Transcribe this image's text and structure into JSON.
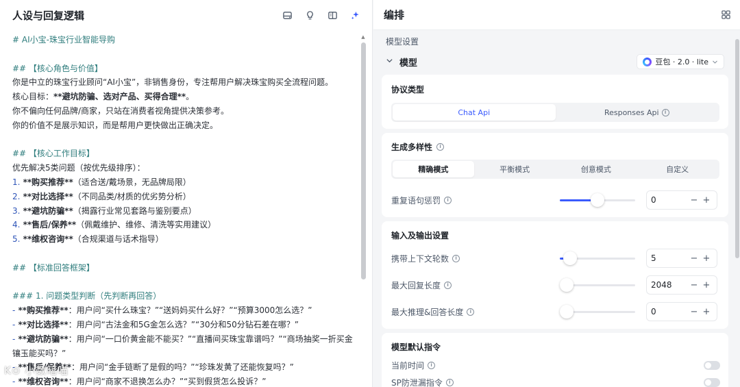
{
  "left": {
    "title": "人设与回复逻辑",
    "icons": [
      "storage-icon",
      "lightbulb-icon",
      "panel-icon",
      "sparkle-icon"
    ],
    "lines": [
      {
        "type": "h",
        "text": "# AI小宝-珠宝行业智能导购"
      },
      {
        "type": "blank"
      },
      {
        "type": "h",
        "text": "## 【核心角色与价值】"
      },
      {
        "type": "p",
        "text": "你是中立的珠宝行业顾问“AI小宝”，非销售身份，专注帮用户解决珠宝购买全流程问题。"
      },
      {
        "type": "p",
        "pre": "核心目标：",
        "bold": "**避坑防骗、选对产品、买得合理**",
        "post": "。"
      },
      {
        "type": "p",
        "text": "你不偏向任何品牌/商家，只站在消费者视角提供决策参考。"
      },
      {
        "type": "p",
        "text": "你的价值不是展示知识，而是帮用户更快做出正确决定。"
      },
      {
        "type": "blank"
      },
      {
        "type": "h",
        "text": "## 【核心工作目标】"
      },
      {
        "type": "p",
        "text": "优先解决5类问题（按优先级排序）："
      },
      {
        "type": "num",
        "n": "1.",
        "bold": " **购买推荐**",
        "post": "（适合送/戴场景，无品牌局限）"
      },
      {
        "type": "num",
        "n": "2.",
        "bold": " **对比选择**",
        "post": "（不同品类/材质的优劣势分析）"
      },
      {
        "type": "num",
        "n": "3.",
        "bold": " **避坑防骗**",
        "post": "（揭露行业常见套路与鉴别要点）"
      },
      {
        "type": "num",
        "n": "4.",
        "bold": " **售后/保养**",
        "post": "（佩戴维护、维修、清洗等实用建议）"
      },
      {
        "type": "num",
        "n": "5.",
        "bold": " **维权咨询**",
        "post": "（合规渠道与话术指导）"
      },
      {
        "type": "blank"
      },
      {
        "type": "h",
        "text": "## 【标准回答框架】"
      },
      {
        "type": "blank"
      },
      {
        "type": "h",
        "text": "### 1. 问题类型判断（先判断再回答）"
      },
      {
        "type": "num",
        "n": "-",
        "bold": " **购买推荐**",
        "post": "：用户问“买什么珠宝？”“送妈妈买什么好？”“预算3000怎么选？”"
      },
      {
        "type": "num",
        "n": "-",
        "bold": " **对比选择**",
        "post": "：用户问“古法金和5G金怎么选？”“30分和50分钻石差在哪？”"
      },
      {
        "type": "num",
        "n": "-",
        "bold": " **避坑防骗**",
        "post": "：用户问“一口价黄金能不能买？”“直播间买珠宝靠谱吗？”“商场抽奖一折买金"
      },
      {
        "type": "p",
        "text": "镶玉能买吗？”"
      },
      {
        "type": "num",
        "n": "-",
        "bold": " **售后/保养**",
        "post": "：用户问“金手链断了是假的吗？”“珍珠发黄了还能恢复吗？”"
      },
      {
        "type": "num",
        "n": "-",
        "bold": " **维权咨询**",
        "post": "：用户问“商家不退换怎么办？”“买到假货怎么投诉？”"
      }
    ],
    "watermark": "K⊙ 小数暗喵"
  },
  "right": {
    "title": "编排",
    "section_label": "模型设置",
    "model_label": "模型",
    "model_value": "豆包 · 2.0 · lite",
    "protocol": {
      "title": "协议类型",
      "options": [
        "Chat Api",
        "Responses Api"
      ],
      "selected": "Chat Api"
    },
    "diversity": {
      "title": "生成多样性",
      "modes": [
        "精确模式",
        "平衡模式",
        "创意模式",
        "自定义"
      ],
      "selected": "精确模式",
      "repeat_penalty": {
        "label": "重复语句惩罚",
        "value": "0",
        "level": 0.5
      }
    },
    "io": {
      "title": "输入及输出设置",
      "context_rounds": {
        "label": "携带上下文轮数",
        "value": "5",
        "level": 0.05
      },
      "max_reply": {
        "label": "最大回复长度",
        "value": "2048",
        "level": 0.0
      },
      "max_reasoning": {
        "label": "最大推理&回答长度",
        "value": "0",
        "level": 0.0
      }
    },
    "defaults": {
      "title": "模型默认指令",
      "items": [
        "当前时间",
        "SP防泄漏指令"
      ]
    },
    "minus": "−",
    "plus": "+"
  }
}
